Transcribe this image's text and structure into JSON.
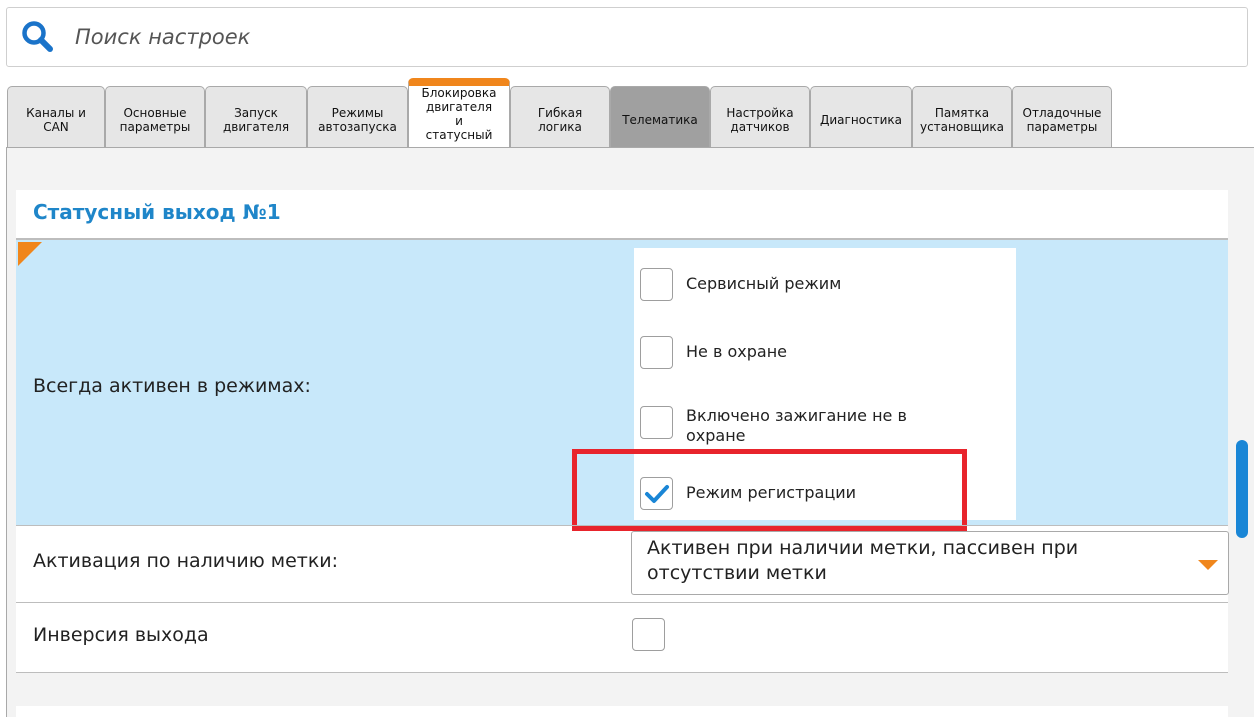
{
  "search": {
    "placeholder": "Поиск настроек",
    "icon": "search-icon"
  },
  "tabs": [
    {
      "label": "Каналы и\nCAN",
      "state": "normal"
    },
    {
      "label": "Основные\nпараметры",
      "state": "normal"
    },
    {
      "label": "Запуск\nдвигателя",
      "state": "normal"
    },
    {
      "label": "Режимы\nавтозапуска",
      "state": "normal"
    },
    {
      "label": "Блокировка\nдвигателя\nи\nстатусный",
      "state": "active"
    },
    {
      "label": "Гибкая\nлогика",
      "state": "normal"
    },
    {
      "label": "Телематика",
      "state": "grey"
    },
    {
      "label": "Настройка\nдатчиков",
      "state": "normal"
    },
    {
      "label": "Диагностика",
      "state": "normal"
    },
    {
      "label": "Памятка\nустановщика",
      "state": "normal"
    },
    {
      "label": "Отладочные\nпараметры",
      "state": "normal"
    }
  ],
  "section": {
    "title": "Статусный выход №1",
    "always_active": {
      "label": "Всегда активен в режимах:",
      "options": [
        {
          "label": "Сервисный режим",
          "checked": false
        },
        {
          "label": "Не в охране",
          "checked": false
        },
        {
          "label": "Включено зажигание не в охране",
          "checked": false
        },
        {
          "label": "Режим регистрации",
          "checked": true
        }
      ]
    },
    "tag_activation": {
      "label": "Активация по наличию метки:",
      "selected": "Активен при наличии метки, пассивен при отсутствии метки"
    },
    "output_inversion": {
      "label": "Инверсия выхода",
      "checked": false
    }
  },
  "colors": {
    "accent_orange": "#f0861c",
    "title_blue": "#1f86c9",
    "highlight_row": "#c8e8fa",
    "annotation_red": "#e8242c",
    "scroll_thumb": "#1a86d6",
    "check_blue": "#1a86d6"
  }
}
